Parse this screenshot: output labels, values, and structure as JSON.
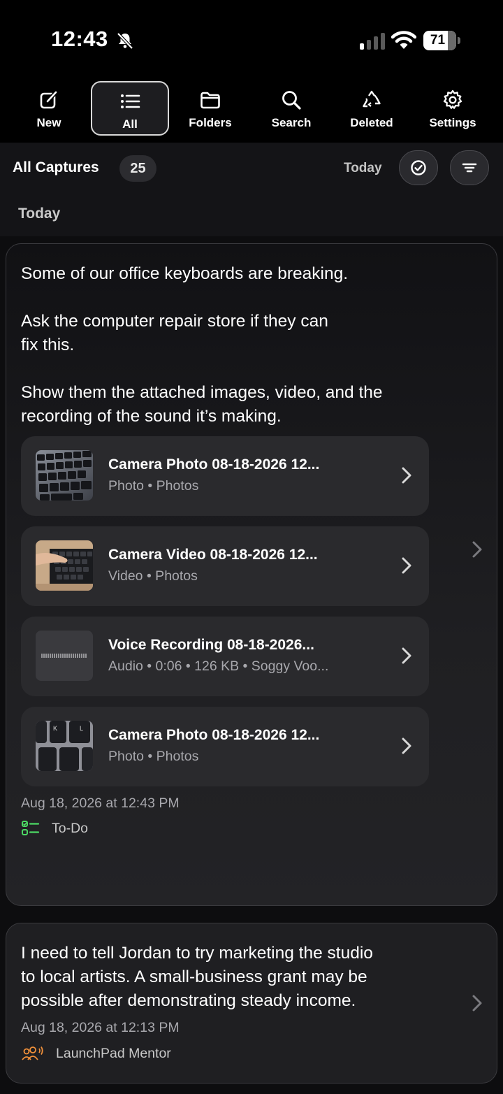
{
  "status": {
    "time": "12:43",
    "battery": "71"
  },
  "toolbar": {
    "items": [
      {
        "label": "New",
        "icon": "compose-icon"
      },
      {
        "label": "All",
        "icon": "list-icon",
        "active": true
      },
      {
        "label": "Folders",
        "icon": "folder-icon"
      },
      {
        "label": "Search",
        "icon": "search-icon"
      },
      {
        "label": "Deleted",
        "icon": "recycle-icon"
      },
      {
        "label": "Settings",
        "icon": "gear-icon"
      }
    ]
  },
  "header": {
    "title": "All Captures",
    "count": "25",
    "sort_label": "Today"
  },
  "section": {
    "label": "Today"
  },
  "captures": [
    {
      "text_lines": [
        "Some of our office keyboards are breaking.",
        "",
        "Ask the computer repair store if they can",
        "fix this.",
        "",
        "Show them the attached images, video, and the",
        "recording of the sound it’s making."
      ],
      "attachments": [
        {
          "title": "Camera Photo 08-18-2026 12...",
          "subtitle": "Photo • Photos",
          "thumb": "keyboard-photo"
        },
        {
          "title": "Camera Video 08-18-2026 12...",
          "subtitle": "Video • Photos",
          "thumb": "keyboard-video"
        },
        {
          "title": "Voice Recording 08-18-2026...",
          "subtitle": "Audio • 0:06 • 126 KB • Soggy Voo...",
          "thumb": "waveform"
        },
        {
          "title": "Camera Photo 08-18-2026 12...",
          "subtitle": "Photo • Photos",
          "thumb": "keycaps-photo"
        }
      ],
      "date": "Aug 18, 2026 at 12:43 PM",
      "tag": {
        "label": "To-Do",
        "icon": "checklist-icon",
        "color": "#4cd964"
      }
    },
    {
      "text_lines": [
        "I need to tell Jordan to try marketing the studio",
        "to local artists. A small-business grant may be",
        "possible after demonstrating steady income."
      ],
      "date": "Aug 18, 2026 at 12:13 PM",
      "tag": {
        "label": "LaunchPad Mentor",
        "icon": "group-speaking-icon",
        "color": "#f0903a"
      }
    }
  ]
}
